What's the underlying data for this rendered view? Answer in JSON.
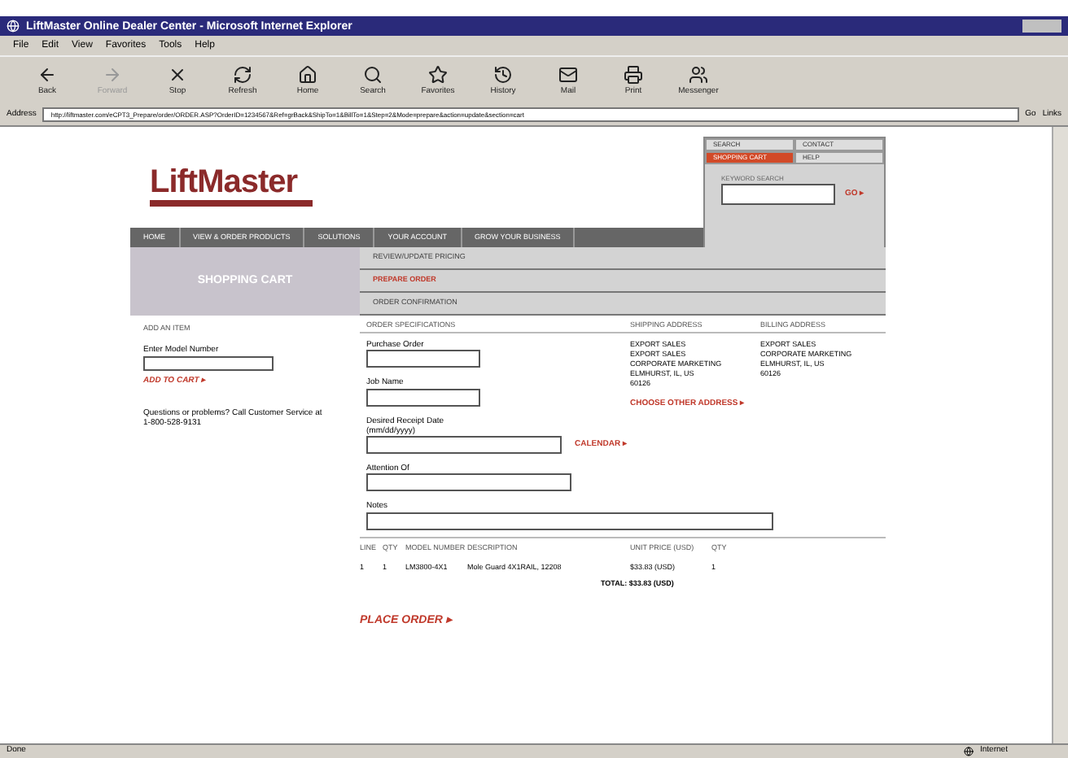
{
  "window": {
    "title": "LiftMaster Online Dealer Center - Microsoft Internet Explorer"
  },
  "menu": [
    "File",
    "Edit",
    "View",
    "Favorites",
    "Tools",
    "Help"
  ],
  "toolbar": [
    {
      "label": "Back",
      "kind": "back",
      "disabled": false
    },
    {
      "label": "Forward",
      "kind": "forward",
      "disabled": true
    },
    {
      "label": "Stop",
      "kind": "stop",
      "disabled": false
    },
    {
      "label": "Refresh",
      "kind": "refresh",
      "disabled": false
    },
    {
      "label": "Home",
      "kind": "home",
      "disabled": false
    },
    {
      "label": "Search",
      "kind": "search",
      "disabled": false
    },
    {
      "label": "Favorites",
      "kind": "favorites",
      "disabled": false
    },
    {
      "label": "History",
      "kind": "history",
      "disabled": false
    },
    {
      "label": "Mail",
      "kind": "mail",
      "disabled": false
    },
    {
      "label": "Print",
      "kind": "print",
      "disabled": false
    },
    {
      "label": "Messenger",
      "kind": "messenger",
      "disabled": false
    }
  ],
  "address_bar": {
    "label": "Address",
    "url": "http://liftmaster.com/eCPT3_Prepare/order/ORDER.ASP?OrderID=1234567&Ref=grBack&ShipTo=1&BillTo=1&Step=2&Mode=prepare&action=update&section=cart",
    "go": "Go",
    "links": "Links"
  },
  "page": {
    "logo": "LiftMaster",
    "utility_tabs": [
      {
        "label": "SEARCH",
        "selected": false
      },
      {
        "label": "CONTACT",
        "selected": false
      },
      {
        "label": "SHOPPING CART",
        "selected": true
      },
      {
        "label": "HELP",
        "selected": false
      }
    ],
    "search": {
      "label": "KEYWORD SEARCH",
      "go": "GO ▸"
    },
    "nav": [
      "HOME",
      "VIEW & ORDER PRODUCTS",
      "SOLUTIONS",
      "YOUR ACCOUNT",
      "GROW YOUR BUSINESS"
    ],
    "section_title": "SHOPPING CART",
    "steps": [
      {
        "label": "REVIEW/UPDATE PRICING",
        "selected": false
      },
      {
        "label": "PREPARE ORDER",
        "selected": true
      },
      {
        "label": "ORDER CONFIRMATION",
        "selected": false
      }
    ],
    "add_item": {
      "heading": "ADD AN ITEM",
      "label": "Enter Model Number",
      "button": "ADD TO CART ▸",
      "help": "Questions or problems? Call Customer Service at 1-800-528-9131"
    },
    "order": {
      "heading": "ORDER SPECIFICATIONS",
      "shipping_heading": "SHIPPING ADDRESS",
      "billing_heading": "BILLING ADDRESS",
      "fields": [
        {
          "label": "Purchase Order",
          "kind": "short"
        },
        {
          "label": "Job Name",
          "kind": "short"
        },
        {
          "label": "Desired Receipt Date\n(mm/dd/yyyy)",
          "kind": "medium",
          "action": "CALENDAR ▸"
        },
        {
          "label": "Attention Of",
          "kind": "long"
        },
        {
          "label": "Notes",
          "kind": "full"
        }
      ],
      "shipping_address": [
        "EXPORT SALES",
        "EXPORT SALES",
        "CORPORATE MARKETING",
        "ELMHURST, IL, US",
        "60126"
      ],
      "billing_address": [
        "EXPORT SALES",
        "CORPORATE MARKETING",
        "ELMHURST, IL, US",
        "60126"
      ],
      "choose_address": "CHOOSE OTHER ADDRESS ▸"
    },
    "cart_table": {
      "columns": [
        "LINE",
        "QTY",
        "MODEL NUMBER",
        "DESCRIPTION",
        "UNIT PRICE (USD)",
        "QTY"
      ],
      "rows": [
        [
          "1",
          "1",
          "LM3800-4X1",
          "Mole Guard 4X1RAIL, 12208",
          "$33.83 (USD)",
          "1"
        ]
      ],
      "total": "TOTAL: $33.83 (USD)"
    },
    "place_order": "PLACE ORDER ▸"
  },
  "status_bar": {
    "text": "Done",
    "zone": "Internet"
  }
}
